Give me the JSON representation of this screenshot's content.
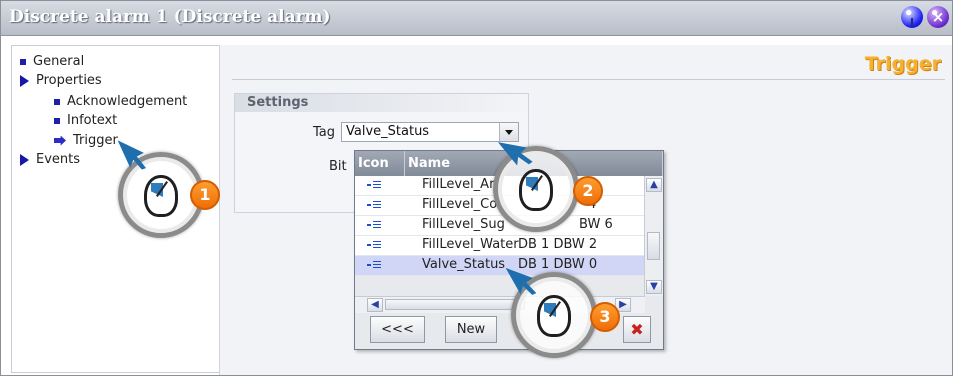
{
  "window": {
    "title": "Discrete alarm 1 (Discrete alarm)",
    "help_icon": "help-icon",
    "close_icon": "close-icon"
  },
  "sidebar": {
    "items": [
      {
        "label": "General",
        "icon": "square-bullet-icon"
      },
      {
        "label": "Properties",
        "icon": "expand-arrow-icon"
      },
      {
        "label": "Acknowledgement",
        "icon": "square-bullet-icon"
      },
      {
        "label": "Infotext",
        "icon": "square-bullet-icon"
      },
      {
        "label": "Trigger",
        "icon": "selected-arrow-icon"
      },
      {
        "label": "Events",
        "icon": "expand-arrow-icon"
      }
    ]
  },
  "main": {
    "section_title": "Trigger",
    "settings_title": "Settings",
    "tag_label": "Tag",
    "bit_label": "Bit",
    "tag_value": "Valve_Status"
  },
  "popup": {
    "columns": [
      "Icon",
      "Name"
    ],
    "rows": [
      {
        "name": "FillLevel_Aro",
        "address": "",
        "icon": "tag-icon"
      },
      {
        "name": "FillLevel_Cor",
        "address": "4",
        "icon": "tag-icon"
      },
      {
        "name": "FillLevel_Sug",
        "address": "BW 6",
        "icon": "tag-icon"
      },
      {
        "name": "FillLevel_Water",
        "address": "DB 1 DBW 2",
        "icon": "tag-icon"
      },
      {
        "name": "Valve_Status",
        "address": "DB 1 DBW 0",
        "icon": "tag-icon",
        "selected": true
      }
    ],
    "buttons": {
      "back": "<<<",
      "new": "New",
      "cancel": "✖"
    }
  },
  "callouts": [
    {
      "number": "1"
    },
    {
      "number": "2"
    },
    {
      "number": "3"
    }
  ],
  "colors": {
    "title_text": "#ffffff",
    "accent_orange": "#f5b12d",
    "selection": "#d2d6f6",
    "navigation_blue": "#1718a6"
  }
}
